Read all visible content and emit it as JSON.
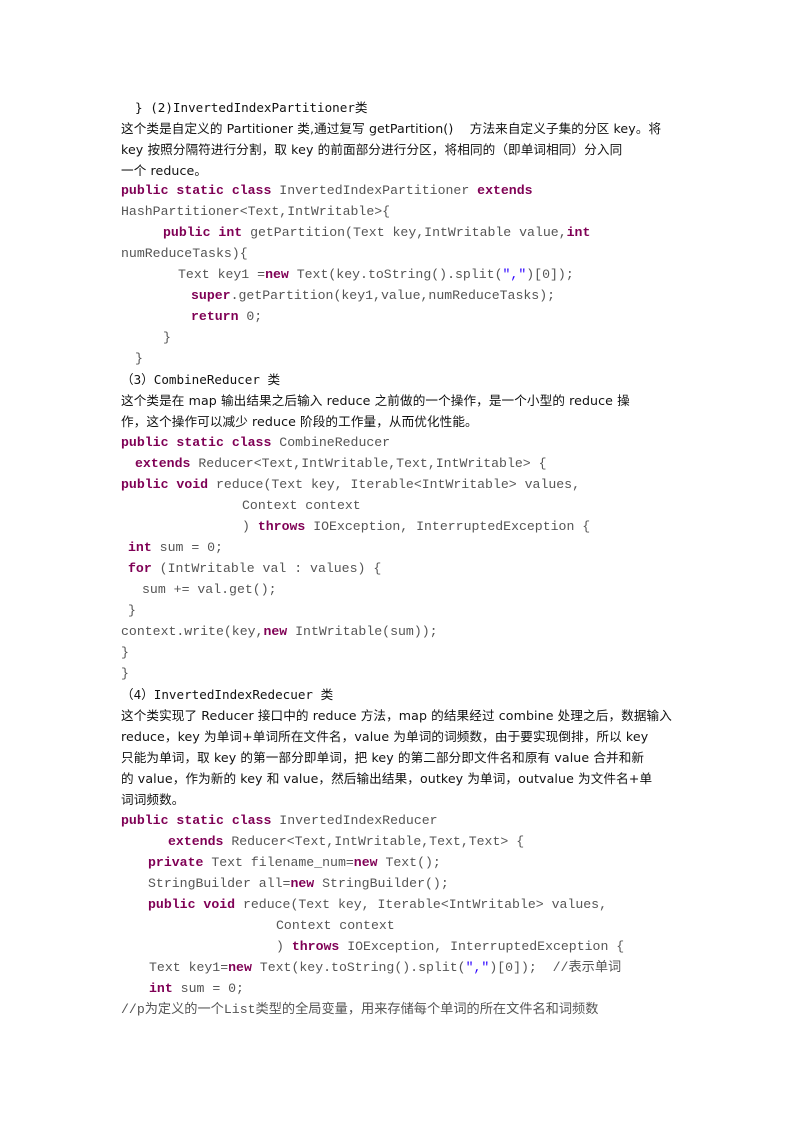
{
  "document": {
    "sections": {
      "s2": {
        "heading_prefix": "}",
        "heading": "(2)InvertedIndexPartitioner",
        "heading_suffix": "类",
        "desc": [
          "这个类是自定义的 Partitioner 类,通过复写 getPartition()    方法来自定义子集的分区 key。将",
          "key 按照分隔符进行分割，取 key 的前面部分进行分区，将相同的（即单词相同）分入同",
          "一个 reduce。"
        ]
      },
      "s3": {
        "heading": "（3）CombineReducer",
        "heading_suffix": "类",
        "desc": [
          "这个类是在 map 输出结果之后输入 reduce 之前做的一个操作，是一个小型的 reduce 操",
          "作，这个操作可以减少 reduce 阶段的工作量，从而优化性能。"
        ]
      },
      "s4": {
        "heading": "（4）InvertedIndexRedecuer",
        "heading_suffix": "类",
        "desc": [
          "这个类实现了 Reducer 接口中的 reduce 方法，map 的结果经过 combine 处理之后，数据输入",
          "reduce，key 为单词+单词所在文件名，value 为单词的词频数，由于要实现倒排，所以 key",
          "只能为单词，取 key 的第一部分即单词，把 key 的第二部分即文件名和原有 value 合并和新",
          "的 value，作为新的 key 和 value，然后输出结果，outkey 为单词，outvalue 为文件名+单",
          "词词频数。"
        ]
      }
    },
    "code": {
      "kw": {
        "public": "public",
        "static": "static",
        "class": "class",
        "extends": "extends",
        "int": "int",
        "new": "new",
        "super": "super",
        "return": "return",
        "void": "void",
        "throws": "throws",
        "for": "for",
        "private": "private"
      },
      "str_comma": "\",\"",
      "p1": [
        " InvertedIndexPartitioner ",
        "HashPartitioner<Text,IntWritable>{",
        " getPartition(Text key,IntWritable value,",
        "numReduceTasks){",
        "Text key1 =",
        " Text(key.toString().split(",
        ")[0]);",
        ".getPartition(key1,value,numReduceTasks);",
        " 0;",
        "}",
        "}"
      ],
      "p2": [
        " CombineReducer",
        " Reducer<Text,IntWritable,Text,IntWritable> {",
        " reduce(Text key, Iterable<IntWritable> values,",
        "Context context",
        ") ",
        " IOException, InterruptedException {",
        " sum = 0;",
        " (IntWritable val : values) {",
        "sum += val.get();",
        "}",
        "context.write(key,",
        " IntWritable(sum));",
        "}",
        "}"
      ],
      "p3": [
        " InvertedIndexReducer",
        " Reducer<Text,IntWritable,Text,Text> {",
        " Text filename_num=",
        " Text();",
        "StringBuilder all=",
        " StringBuilder();",
        " reduce(Text key, Iterable<IntWritable> values,",
        "Context context",
        ") ",
        " IOException, InterruptedException {",
        "Text key1=",
        " Text(key.toString().split(",
        ")[0]);  //表示单词",
        " sum = 0;",
        "//p为定义的一个List类型的全局变量，用来存储每个单词的所在文件名和词频数"
      ]
    }
  }
}
